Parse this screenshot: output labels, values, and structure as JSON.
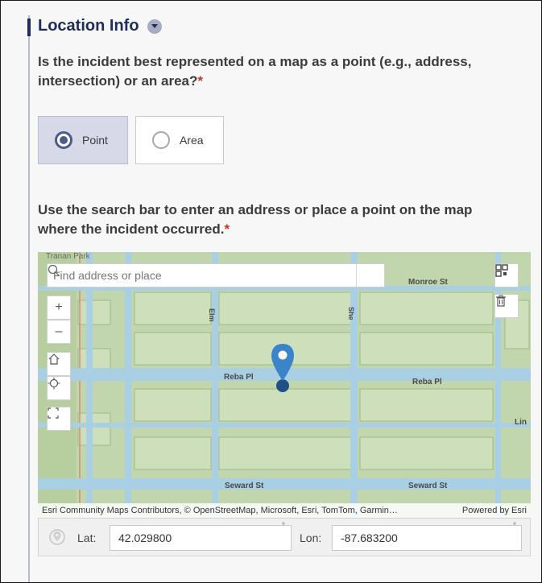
{
  "section": {
    "title": "Location Info"
  },
  "question1": {
    "text": "Is the incident best represented on a map as a point  (e.g., address, intersection) or an area?",
    "required_mark": "*"
  },
  "options": [
    {
      "label": "Point",
      "selected": true
    },
    {
      "label": "Area",
      "selected": false
    }
  ],
  "question2": {
    "text": "Use the search bar to enter an address or place a point on the map where the incident occurred.",
    "required_mark": "*"
  },
  "map": {
    "search_placeholder": "Find address or place",
    "streets": {
      "monroe": "Monroe St",
      "reba_west": "Reba Pl",
      "reba_east": "Reba Pl",
      "seward_west": "Seward St",
      "seward_east": "Seward St",
      "elm": "Elm",
      "sheridan": "She",
      "lin": "Lin",
      "park": "Tranan Park"
    },
    "attribution": "Esri Community Maps Contributors, © OpenStreetMap, Microsoft, Esri, TomTom, Garmin…",
    "powered_by": "Powered by Esri",
    "zoom_in": "+",
    "zoom_out": "–"
  },
  "coordinates": {
    "lat_label": "Lat:",
    "lat_value": "42.029800",
    "lon_label": "Lon:",
    "lon_value": "-87.683200",
    "degree_symbol": "°"
  },
  "colors": {
    "accent": "#1f2d5c",
    "selected_bg": "#d7d9e9",
    "pin": "#3b84c9",
    "map_block": "#c2d6ae",
    "map_street": "#a9cfe4"
  }
}
